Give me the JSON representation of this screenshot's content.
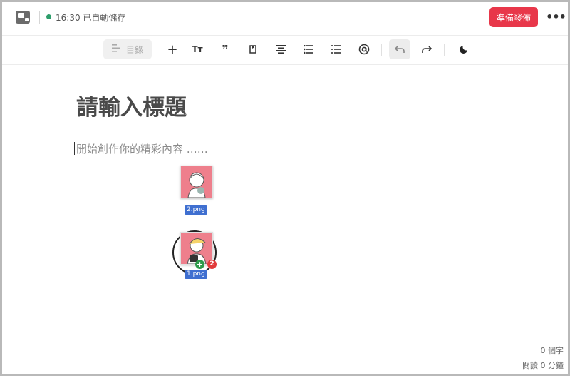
{
  "header": {
    "status_time": "16:30",
    "status_text": "已自動儲存",
    "publish_label": "準備發佈",
    "more_label": "•••",
    "status_dot_color": "#2e9e6b",
    "accent_color": "#e8374a"
  },
  "toolbar": {
    "toc_label": "目錄",
    "insert_label": "+",
    "text_style_label": "Tт",
    "quote_label": "❞",
    "icons": [
      "toc-icon",
      "plus-icon",
      "text-size-icon",
      "quote-icon",
      "attach-icon",
      "align-center-icon",
      "bullet-list-icon",
      "numbered-list-icon",
      "mention-icon",
      "undo-icon",
      "redo-icon",
      "dark-mode-icon"
    ]
  },
  "editor": {
    "title_placeholder": "請輸入標題",
    "body_placeholder": "開始創作你的精彩內容 ……"
  },
  "drag": {
    "file1_name": "2.png",
    "file2_name": "1.png",
    "plus": "+",
    "count": "2"
  },
  "footer": {
    "word_count": "0 個字",
    "read_time": "閱讀 0 分鐘"
  }
}
